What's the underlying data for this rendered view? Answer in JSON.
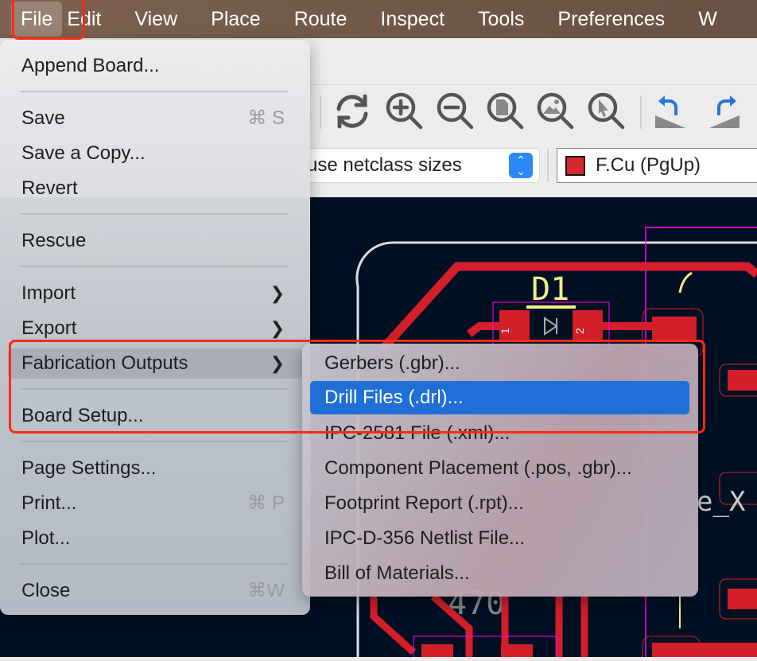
{
  "menubar": {
    "items": [
      "File",
      "Edit",
      "View",
      "Place",
      "Route",
      "Inspect",
      "Tools",
      "Preferences",
      "W"
    ]
  },
  "toolbar": {
    "icons": [
      "refresh-icon",
      "zoom-in-icon",
      "zoom-out-icon",
      "zoom-page-icon",
      "zoom-fit-icon",
      "zoom-selection-icon",
      "undo-icon",
      "redo-icon"
    ],
    "track_width_select": "use netclass sizes",
    "layer_select": "F.Cu (PgUp)",
    "layer_color": "#d42a2e"
  },
  "file_menu": {
    "items": [
      {
        "label": "Append Board..."
      },
      {
        "label": "Save",
        "shortcut": "⌘ S"
      },
      {
        "label": "Save a Copy..."
      },
      {
        "label": "Revert"
      },
      {
        "label": "Rescue"
      },
      {
        "label": "Import"
      },
      {
        "label": "Export"
      },
      {
        "label": "Fabrication Outputs"
      },
      {
        "label": "Board Setup..."
      },
      {
        "label": "Page Settings..."
      },
      {
        "label": "Print...",
        "shortcut": "⌘ P"
      },
      {
        "label": "Plot..."
      },
      {
        "label": "Close",
        "shortcut": "⌘W"
      }
    ]
  },
  "fabrication_submenu": {
    "items": [
      "Gerbers (.gbr)...",
      "Drill Files (.drl)...",
      "IPC-2581 File (.xml)...",
      "Component Placement (.pos, .gbr)...",
      "Footprint Report (.rpt)...",
      "IPC-D-356 Netlist File...",
      "Bill of Materials..."
    ],
    "selected": "Drill Files (.drl)..."
  },
  "pcb": {
    "ref_d1": "D1",
    "pad1": "1",
    "pad2": "2",
    "value_text": "470",
    "partial_label": "e_X"
  },
  "colors": {
    "highlight": "#1f6fd6",
    "annotation": "#ff2a12",
    "copper": "#d42a2e",
    "canvas": "#001023"
  }
}
